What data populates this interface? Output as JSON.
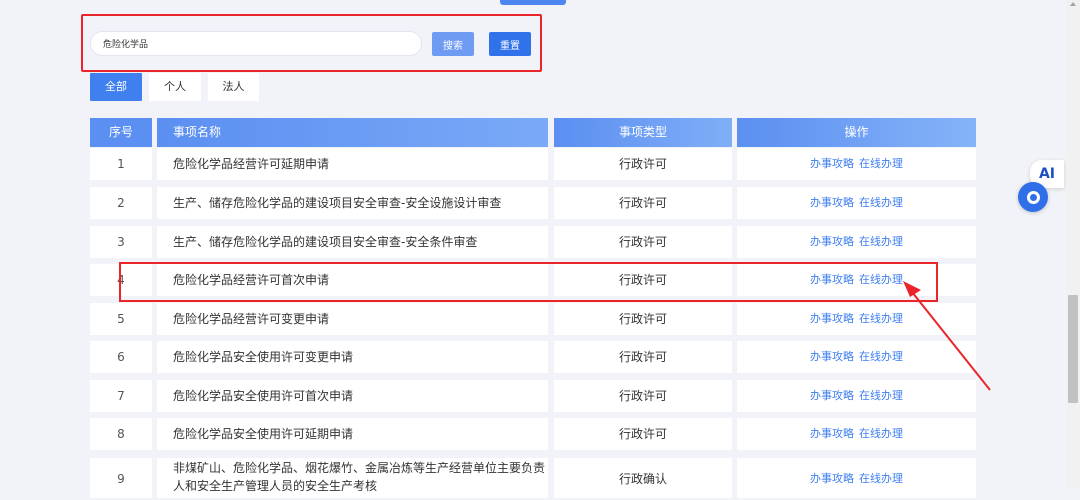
{
  "search": {
    "value": "危险化学品",
    "search_label": "搜索",
    "reset_label": "重置"
  },
  "filter_tabs": [
    "全部",
    "个人",
    "法人"
  ],
  "table": {
    "headers": [
      "序号",
      "事项名称",
      "事项类型",
      "操作"
    ],
    "guide_label": "办事攻略",
    "online_label": "在线办理",
    "rows": [
      {
        "seq": "1",
        "name": "危险化学品经营许可延期申请",
        "type": "行政许可"
      },
      {
        "seq": "2",
        "name": "生产、储存危险化学品的建设项目安全审查-安全设施设计审查",
        "type": "行政许可"
      },
      {
        "seq": "3",
        "name": "生产、储存危险化学品的建设项目安全审查-安全条件审查",
        "type": "行政许可"
      },
      {
        "seq": "4",
        "name": "危险化学品经营许可首次申请",
        "type": "行政许可"
      },
      {
        "seq": "5",
        "name": "危险化学品经营许可变更申请",
        "type": "行政许可"
      },
      {
        "seq": "6",
        "name": "危险化学品安全使用许可变更申请",
        "type": "行政许可"
      },
      {
        "seq": "7",
        "name": "危险化学品安全使用许可首次申请",
        "type": "行政许可"
      },
      {
        "seq": "8",
        "name": "危险化学品安全使用许可延期申请",
        "type": "行政许可"
      },
      {
        "seq": "9",
        "name": "非煤矿山、危险化学品、烟花爆竹、金属冶炼等生产经营单位主要负责人和安全生产管理人员的安全生产考核",
        "type": "行政确认"
      }
    ]
  },
  "widget": {
    "text": "AI"
  },
  "colors": {
    "accent": "#3f7ff0",
    "highlight": "#e9252a"
  }
}
